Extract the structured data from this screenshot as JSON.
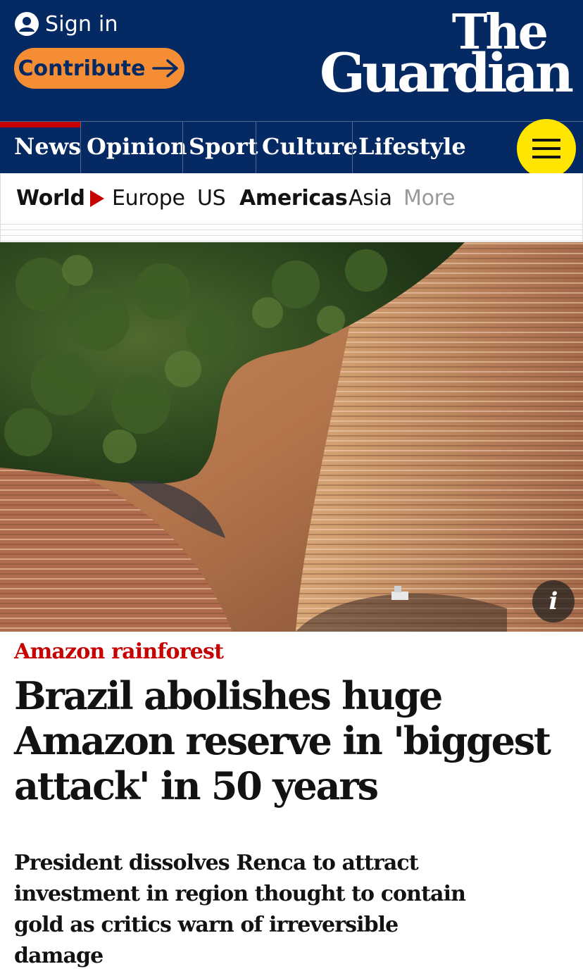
{
  "header": {
    "sign_in_label": "Sign in",
    "contribute_label": "Contribute",
    "logo_line1": "The",
    "logo_line2": "Guardian",
    "colors": {
      "brand_blue": "#052962",
      "contribute_orange": "#f58d34",
      "menu_yellow": "#ffe500",
      "news_red": "#c70000"
    }
  },
  "pillars": [
    {
      "label": "News",
      "active": true
    },
    {
      "label": "Opinion"
    },
    {
      "label": "Sport"
    },
    {
      "label": "Culture"
    },
    {
      "label": "Lifestyle"
    }
  ],
  "menu_icon": "hamburger-icon",
  "subnav": {
    "items": [
      "World",
      "Europe",
      "US",
      "Americas",
      "Asia",
      "More"
    ]
  },
  "hero": {
    "info_label": "i"
  },
  "article": {
    "kicker": "Amazon rainforest",
    "headline": "Brazil abolishes huge Amazon reserve in 'biggest attack' in 50 years",
    "standfirst": "President dissolves Renca to attract investment in region thought to contain gold as critics warn of irreversible damage"
  }
}
